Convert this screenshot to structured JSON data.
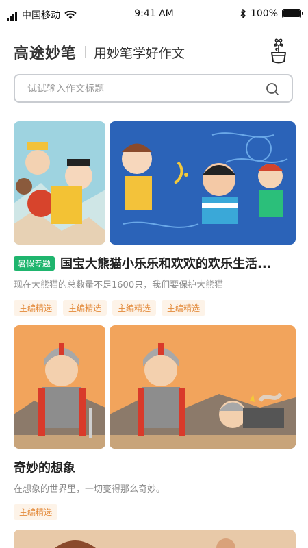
{
  "status_bar": {
    "carrier": "中国移动",
    "time": "9:41 AM",
    "battery": "100%",
    "battery_level": 1.0
  },
  "header": {
    "logo_text": "高途妙笔",
    "slogan": "用妙笔学好作文"
  },
  "search": {
    "placeholder": "试试输入作文标题"
  },
  "cards": [
    {
      "badge": "暑假专题",
      "title": "国宝大熊猫小乐乐和欢欢的欢乐生活...",
      "description": "现在大熊猫的总数量不足1600只，我们要保护大熊猫",
      "tags": [
        "主编精选",
        "主编精选",
        "主编精选",
        "主编精选"
      ]
    },
    {
      "title": "奇妙的想象",
      "description": "在想象的世界里，一切变得那么奇妙。",
      "tags": [
        "主编精选"
      ]
    }
  ],
  "colors": {
    "badge_green": "#1fb56e",
    "tag_orange": "#e38a3a",
    "tag_bg": "#fdf3e8"
  },
  "icons": [
    "signal-icon",
    "wifi-icon",
    "bluetooth-icon",
    "battery-icon",
    "plant-pot-icon",
    "search-icon"
  ]
}
